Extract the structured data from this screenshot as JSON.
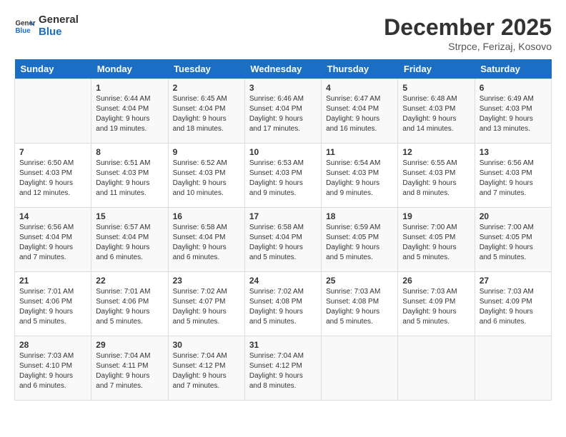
{
  "logo": {
    "line1": "General",
    "line2": "Blue"
  },
  "title": "December 2025",
  "location": "Strpce, Ferizaj, Kosovo",
  "days_header": [
    "Sunday",
    "Monday",
    "Tuesday",
    "Wednesday",
    "Thursday",
    "Friday",
    "Saturday"
  ],
  "weeks": [
    [
      {
        "num": "",
        "info": ""
      },
      {
        "num": "1",
        "info": "Sunrise: 6:44 AM\nSunset: 4:04 PM\nDaylight: 9 hours\nand 19 minutes."
      },
      {
        "num": "2",
        "info": "Sunrise: 6:45 AM\nSunset: 4:04 PM\nDaylight: 9 hours\nand 18 minutes."
      },
      {
        "num": "3",
        "info": "Sunrise: 6:46 AM\nSunset: 4:04 PM\nDaylight: 9 hours\nand 17 minutes."
      },
      {
        "num": "4",
        "info": "Sunrise: 6:47 AM\nSunset: 4:04 PM\nDaylight: 9 hours\nand 16 minutes."
      },
      {
        "num": "5",
        "info": "Sunrise: 6:48 AM\nSunset: 4:03 PM\nDaylight: 9 hours\nand 14 minutes."
      },
      {
        "num": "6",
        "info": "Sunrise: 6:49 AM\nSunset: 4:03 PM\nDaylight: 9 hours\nand 13 minutes."
      }
    ],
    [
      {
        "num": "7",
        "info": "Sunrise: 6:50 AM\nSunset: 4:03 PM\nDaylight: 9 hours\nand 12 minutes."
      },
      {
        "num": "8",
        "info": "Sunrise: 6:51 AM\nSunset: 4:03 PM\nDaylight: 9 hours\nand 11 minutes."
      },
      {
        "num": "9",
        "info": "Sunrise: 6:52 AM\nSunset: 4:03 PM\nDaylight: 9 hours\nand 10 minutes."
      },
      {
        "num": "10",
        "info": "Sunrise: 6:53 AM\nSunset: 4:03 PM\nDaylight: 9 hours\nand 9 minutes."
      },
      {
        "num": "11",
        "info": "Sunrise: 6:54 AM\nSunset: 4:03 PM\nDaylight: 9 hours\nand 9 minutes."
      },
      {
        "num": "12",
        "info": "Sunrise: 6:55 AM\nSunset: 4:03 PM\nDaylight: 9 hours\nand 8 minutes."
      },
      {
        "num": "13",
        "info": "Sunrise: 6:56 AM\nSunset: 4:03 PM\nDaylight: 9 hours\nand 7 minutes."
      }
    ],
    [
      {
        "num": "14",
        "info": "Sunrise: 6:56 AM\nSunset: 4:04 PM\nDaylight: 9 hours\nand 7 minutes."
      },
      {
        "num": "15",
        "info": "Sunrise: 6:57 AM\nSunset: 4:04 PM\nDaylight: 9 hours\nand 6 minutes."
      },
      {
        "num": "16",
        "info": "Sunrise: 6:58 AM\nSunset: 4:04 PM\nDaylight: 9 hours\nand 6 minutes."
      },
      {
        "num": "17",
        "info": "Sunrise: 6:58 AM\nSunset: 4:04 PM\nDaylight: 9 hours\nand 5 minutes."
      },
      {
        "num": "18",
        "info": "Sunrise: 6:59 AM\nSunset: 4:05 PM\nDaylight: 9 hours\nand 5 minutes."
      },
      {
        "num": "19",
        "info": "Sunrise: 7:00 AM\nSunset: 4:05 PM\nDaylight: 9 hours\nand 5 minutes."
      },
      {
        "num": "20",
        "info": "Sunrise: 7:00 AM\nSunset: 4:05 PM\nDaylight: 9 hours\nand 5 minutes."
      }
    ],
    [
      {
        "num": "21",
        "info": "Sunrise: 7:01 AM\nSunset: 4:06 PM\nDaylight: 9 hours\nand 5 minutes."
      },
      {
        "num": "22",
        "info": "Sunrise: 7:01 AM\nSunset: 4:06 PM\nDaylight: 9 hours\nand 5 minutes."
      },
      {
        "num": "23",
        "info": "Sunrise: 7:02 AM\nSunset: 4:07 PM\nDaylight: 9 hours\nand 5 minutes."
      },
      {
        "num": "24",
        "info": "Sunrise: 7:02 AM\nSunset: 4:08 PM\nDaylight: 9 hours\nand 5 minutes."
      },
      {
        "num": "25",
        "info": "Sunrise: 7:03 AM\nSunset: 4:08 PM\nDaylight: 9 hours\nand 5 minutes."
      },
      {
        "num": "26",
        "info": "Sunrise: 7:03 AM\nSunset: 4:09 PM\nDaylight: 9 hours\nand 5 minutes."
      },
      {
        "num": "27",
        "info": "Sunrise: 7:03 AM\nSunset: 4:09 PM\nDaylight: 9 hours\nand 6 minutes."
      }
    ],
    [
      {
        "num": "28",
        "info": "Sunrise: 7:03 AM\nSunset: 4:10 PM\nDaylight: 9 hours\nand 6 minutes."
      },
      {
        "num": "29",
        "info": "Sunrise: 7:04 AM\nSunset: 4:11 PM\nDaylight: 9 hours\nand 7 minutes."
      },
      {
        "num": "30",
        "info": "Sunrise: 7:04 AM\nSunset: 4:12 PM\nDaylight: 9 hours\nand 7 minutes."
      },
      {
        "num": "31",
        "info": "Sunrise: 7:04 AM\nSunset: 4:12 PM\nDaylight: 9 hours\nand 8 minutes."
      },
      {
        "num": "",
        "info": ""
      },
      {
        "num": "",
        "info": ""
      },
      {
        "num": "",
        "info": ""
      }
    ]
  ]
}
